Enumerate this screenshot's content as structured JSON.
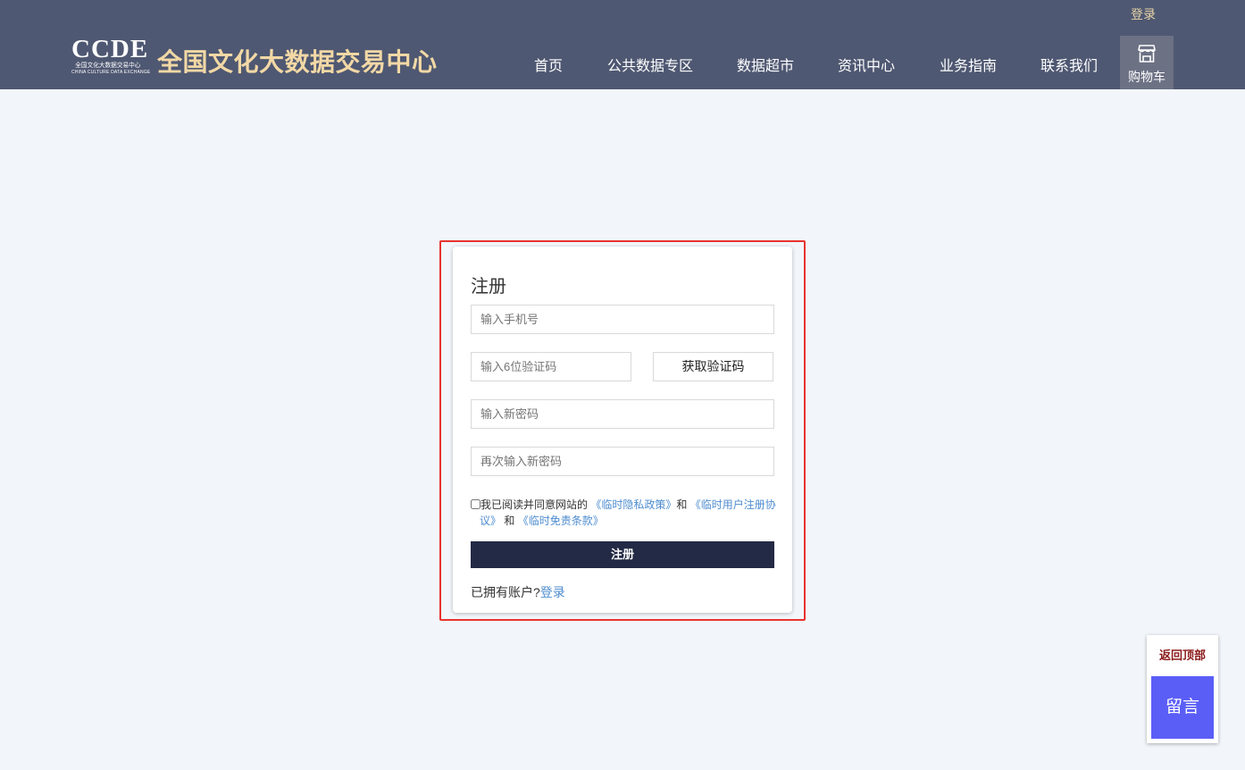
{
  "header": {
    "top_login": "登录",
    "logo": {
      "main": "CCDE",
      "sub_cn": "全国文化大数据交易中心",
      "sub_en": "CHINA CULTURE DATA EXCHANGE"
    },
    "site_title": "全国文化大数据交易中心",
    "nav": [
      "首页",
      "公共数据专区",
      "数据超市",
      "资讯中心",
      "业务指南",
      "联系我们"
    ],
    "cart_label": "购物车",
    "cart_icon": "shop-icon"
  },
  "register": {
    "title": "注册",
    "phone_placeholder": "输入手机号",
    "code_placeholder": "输入6位验证码",
    "get_code_label": "获取验证码",
    "new_password_placeholder": "输入新密码",
    "confirm_password_placeholder": "再次输入新密码",
    "agree_prefix": "我已阅读并同意网站的",
    "privacy_link": "《临时隐私政策》",
    "and1": "和",
    "agreement_link_part1": "《临时用户注册协",
    "agreement_link_part2": "议》",
    "and2": "和",
    "disclaimer_link": "《临时免责条款》",
    "submit_label": "注册",
    "have_account_text": "已拥有账户?",
    "login_link": "登录"
  },
  "float_widget": {
    "back_top_label": "返回顶部",
    "leave_message_label": "留言"
  },
  "colors": {
    "header_bg": "#4f5872",
    "title_gold": "#f2d8a5",
    "page_bg": "#f2f6fa",
    "highlight": "#e8332e",
    "submit_bg": "#232a45",
    "link": "#4d8ccf",
    "message_btn": "#5b5ef6",
    "back_top": "#8b1a1a"
  }
}
